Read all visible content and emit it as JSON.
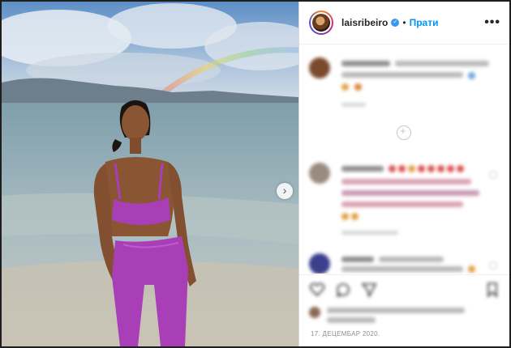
{
  "post": {
    "username": "laisribeiro",
    "verified_icon": "verified-badge-icon",
    "separator": "•",
    "follow_label": "Прати",
    "more_icon": "more-options-icon",
    "more_label": "•••",
    "next_label": "›",
    "date": "17. ДЕЦЕМБАР 2020."
  },
  "icons": {
    "like": "heart-icon",
    "comment": "comment-icon",
    "share": "share-icon",
    "save": "bookmark-icon"
  },
  "colors": {
    "follow": "#0095f6",
    "verified": "#3897f0",
    "outfit": "#a83fb6"
  }
}
